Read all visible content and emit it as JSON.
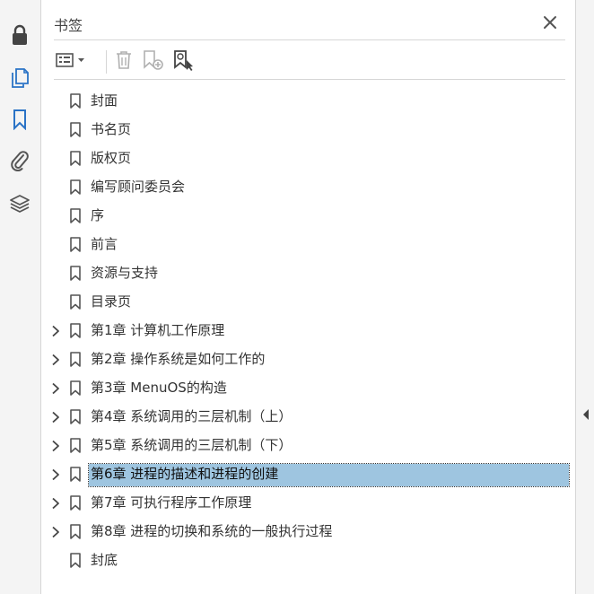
{
  "panel": {
    "title": "书签",
    "close_icon": "close-icon"
  },
  "rail": {
    "icons": [
      "lock-icon",
      "pages-icon",
      "bookmark-icon",
      "attachment-icon",
      "layers-icon"
    ],
    "active": "bookmark-icon"
  },
  "toolbar": {
    "icons": [
      "options-menu-icon",
      "delete-bookmark-icon",
      "new-bookmark-icon",
      "find-bookmark-icon"
    ]
  },
  "bookmarks": [
    {
      "label": "封面",
      "expandable": false,
      "selected": false
    },
    {
      "label": "书名页",
      "expandable": false,
      "selected": false
    },
    {
      "label": "版权页",
      "expandable": false,
      "selected": false
    },
    {
      "label": "编写顾问委员会",
      "expandable": false,
      "selected": false
    },
    {
      "label": "序",
      "expandable": false,
      "selected": false
    },
    {
      "label": "前言",
      "expandable": false,
      "selected": false
    },
    {
      "label": "资源与支持",
      "expandable": false,
      "selected": false
    },
    {
      "label": "目录页",
      "expandable": false,
      "selected": false
    },
    {
      "label": "第1章  计算机工作原理",
      "expandable": true,
      "selected": false
    },
    {
      "label": "第2章  操作系统是如何工作的",
      "expandable": true,
      "selected": false
    },
    {
      "label": "第3章  MenuOS的构造",
      "expandable": true,
      "selected": false
    },
    {
      "label": "第4章  系统调用的三层机制（上）",
      "expandable": true,
      "selected": false
    },
    {
      "label": "第5章  系统调用的三层机制（下）",
      "expandable": true,
      "selected": false
    },
    {
      "label": "第6章  进程的描述和进程的创建",
      "expandable": true,
      "selected": true
    },
    {
      "label": "第7章  可执行程序工作原理",
      "expandable": true,
      "selected": false
    },
    {
      "label": "第8章  进程的切换和系统的一般执行过程",
      "expandable": true,
      "selected": false
    },
    {
      "label": "封底",
      "expandable": false,
      "selected": false
    }
  ],
  "colors": {
    "selection": "#9ec5e0",
    "rail_active": "#2a73c6",
    "icon": "#555555"
  }
}
